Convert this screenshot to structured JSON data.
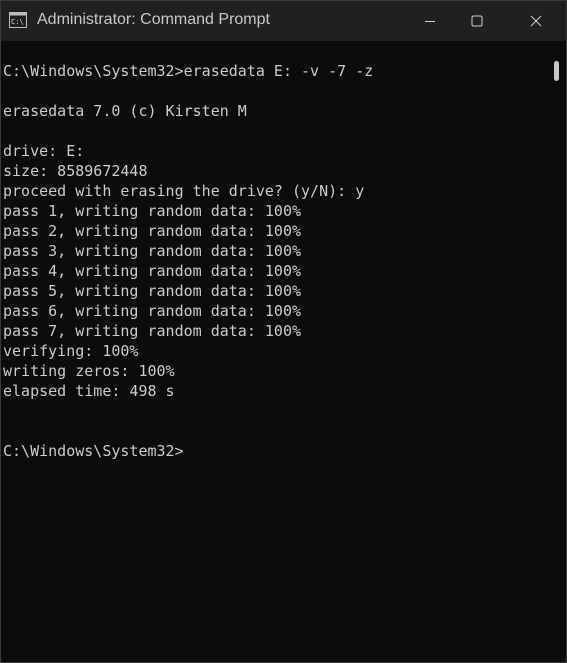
{
  "window": {
    "title": "Administrator: Command Prompt",
    "icon": "command-prompt-icon"
  },
  "console": {
    "lines": [
      "C:\\Windows\\System32>erasedata E: -v -7 -z",
      "",
      "erasedata 7.0 (c) Kirsten M",
      "",
      "drive: E:",
      "size: 8589672448",
      "proceed with erasing the drive? (y/N): y",
      "pass 1, writing random data: 100%",
      "pass 2, writing random data: 100%",
      "pass 3, writing random data: 100%",
      "pass 4, writing random data: 100%",
      "pass 5, writing random data: 100%",
      "pass 6, writing random data: 100%",
      "pass 7, writing random data: 100%",
      "verifying: 100%",
      "writing zeros: 100%",
      "elapsed time: 498 s",
      "",
      "",
      "C:\\Windows\\System32>"
    ]
  },
  "colors": {
    "background": "#0c0c0c",
    "text": "#cccccc",
    "titlebar": "#202020"
  }
}
